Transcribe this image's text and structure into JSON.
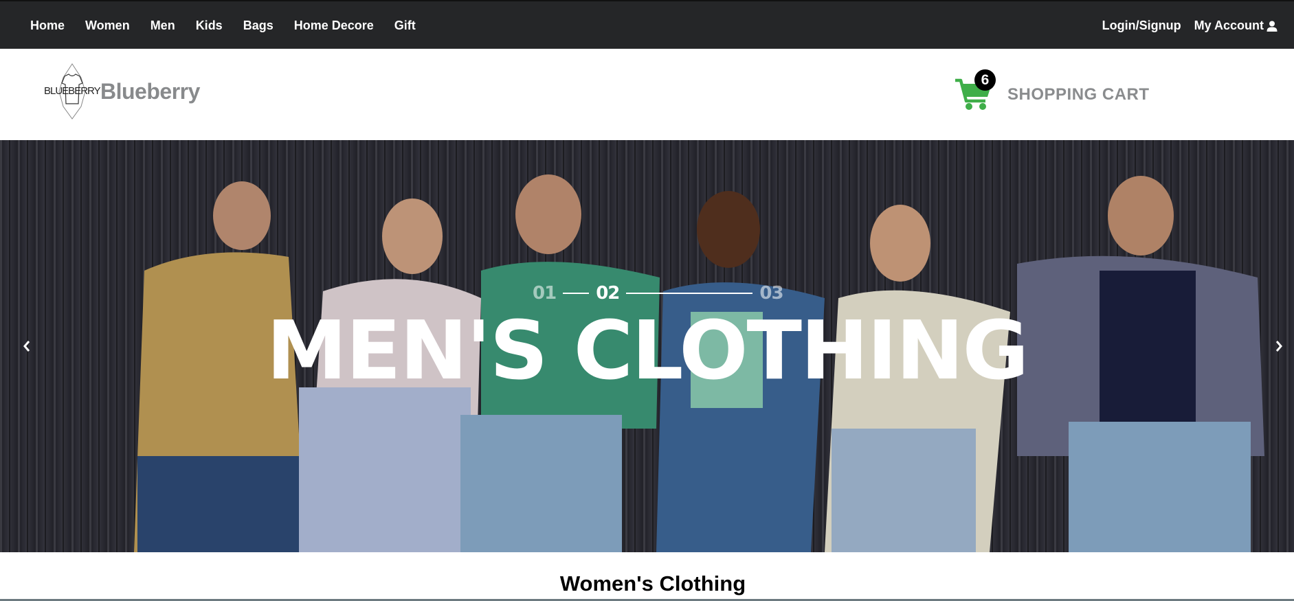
{
  "nav": {
    "items": [
      {
        "label": "Home"
      },
      {
        "label": "Women"
      },
      {
        "label": "Men"
      },
      {
        "label": "Kids"
      },
      {
        "label": "Bags"
      },
      {
        "label": "Home Decore"
      },
      {
        "label": "Gift"
      }
    ],
    "login_label": "Login/Signup",
    "account_label": "My Account",
    "account_icon": "user-icon"
  },
  "header": {
    "logo_tag": "BLUEBERRY",
    "logo_name": "Blueberry",
    "cart_count": "6",
    "cart_label": "SHOPPING CART",
    "cart_color": "#3fae49"
  },
  "hero": {
    "pager": [
      "01",
      "02",
      "03"
    ],
    "active_slide": "02",
    "headline": "MEN'S CLOTHING",
    "prev_icon": "chevron-left-icon",
    "next_icon": "chevron-right-icon"
  },
  "section": {
    "title": "Women's Clothing"
  },
  "colors": {
    "topbar": "#252628",
    "logo_text": "#888a8c",
    "cart_text": "#8a8c8e"
  }
}
